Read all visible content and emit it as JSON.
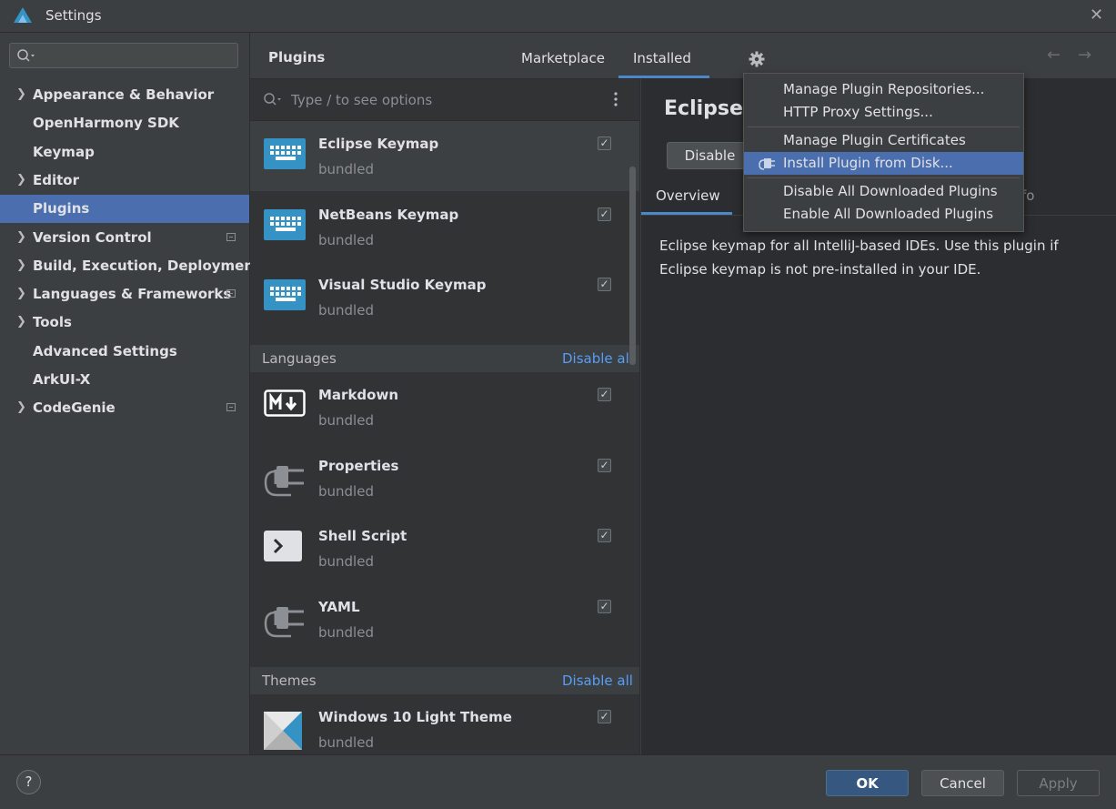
{
  "window": {
    "title": "Settings"
  },
  "sidebar": {
    "search_placeholder": "",
    "items": [
      {
        "label": "Appearance & Behavior",
        "expandable": true,
        "badge": false
      },
      {
        "label": "OpenHarmony SDK",
        "expandable": false,
        "badge": false
      },
      {
        "label": "Keymap",
        "expandable": false,
        "badge": false
      },
      {
        "label": "Editor",
        "expandable": true,
        "badge": false
      },
      {
        "label": "Plugins",
        "expandable": false,
        "badge": false,
        "selected": true
      },
      {
        "label": "Version Control",
        "expandable": true,
        "badge": true
      },
      {
        "label": "Build, Execution, Deployment",
        "expandable": true,
        "badge": false
      },
      {
        "label": "Languages & Frameworks",
        "expandable": true,
        "badge": true
      },
      {
        "label": "Tools",
        "expandable": true,
        "badge": false
      },
      {
        "label": "Advanced Settings",
        "expandable": false,
        "badge": false
      },
      {
        "label": "ArkUI-X",
        "expandable": false,
        "badge": false
      },
      {
        "label": "CodeGenie",
        "expandable": true,
        "badge": true
      }
    ]
  },
  "header": {
    "title": "Plugins",
    "tabs": [
      "Marketplace",
      "Installed"
    ],
    "active_tab": "Installed"
  },
  "list": {
    "search_placeholder": "Type / to see options",
    "keymaps": [
      {
        "name": "Eclipse Keymap",
        "sub": "bundled",
        "icon": "keyboard-icon",
        "checked": true
      },
      {
        "name": "NetBeans Keymap",
        "sub": "bundled",
        "icon": "keyboard-icon",
        "checked": true
      },
      {
        "name": "Visual Studio Keymap",
        "sub": "bundled",
        "icon": "keyboard-icon",
        "checked": true
      }
    ],
    "languages_header": "Languages",
    "languages_action": "Disable all",
    "languages": [
      {
        "name": "Markdown",
        "sub": "bundled",
        "icon": "markdown-icon",
        "checked": true
      },
      {
        "name": "Properties",
        "sub": "bundled",
        "icon": "plug-icon",
        "checked": true
      },
      {
        "name": "Shell Script",
        "sub": "bundled",
        "icon": "terminal-icon",
        "checked": true
      },
      {
        "name": "YAML",
        "sub": "bundled",
        "icon": "plug-icon",
        "checked": true
      }
    ],
    "themes_header": "Themes",
    "themes_action": "Disable all",
    "themes": [
      {
        "name": "Windows 10 Light Theme",
        "sub": "bundled",
        "icon": "theme-icon",
        "checked": true
      }
    ]
  },
  "detail": {
    "title": "Eclipse K",
    "disable_label": "Disable",
    "tab_overview": "Overview",
    "tab_partial": "fo",
    "description": "Eclipse keymap for all IntelliJ-based IDEs. Use this plugin if Eclipse keymap is not pre-installed in your IDE."
  },
  "popup": {
    "items": [
      "Manage Plugin Repositories...",
      "HTTP Proxy Settings...",
      "Manage Plugin Certificates",
      "Install Plugin from Disk...",
      "Disable All Downloaded Plugins",
      "Enable All Downloaded Plugins"
    ],
    "highlighted": "Install Plugin from Disk..."
  },
  "footer": {
    "help": "?",
    "ok": "OK",
    "cancel": "Cancel",
    "apply": "Apply"
  },
  "colors": {
    "accent": "#4b6eaf",
    "link": "#589df6",
    "keymap_icon": "#3592c4"
  }
}
